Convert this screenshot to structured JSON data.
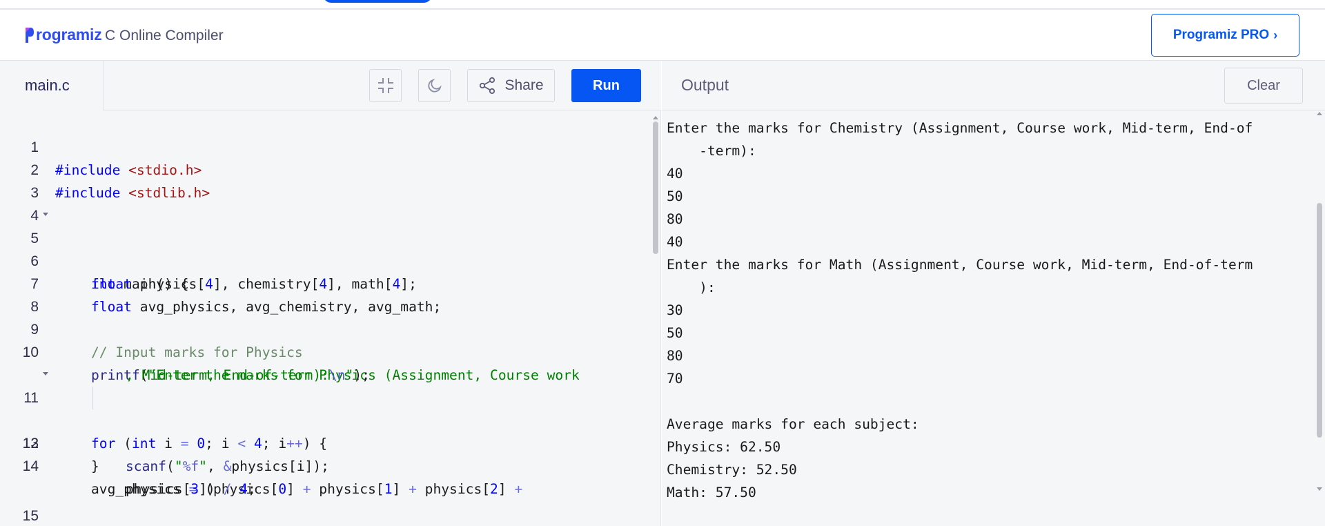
{
  "header": {
    "logo_text": "rogramiz",
    "title": "C Online Compiler",
    "pro_button": "Programiz PRO",
    "pro_chevron": "›"
  },
  "editor": {
    "file_tab": "main.c",
    "share_label": "Share",
    "run_label": "Run",
    "icons": [
      "collapse-icon",
      "moon-icon",
      "share-icon"
    ],
    "lines": [
      {
        "n": "1",
        "text": "#include <stdio.h>"
      },
      {
        "n": "2",
        "text": "#include <stdlib.h>"
      },
      {
        "n": "3",
        "text": ""
      },
      {
        "n": "4",
        "text": ""
      },
      {
        "n": "5",
        "text": "int main() {"
      },
      {
        "n": "6",
        "text": "float physics[4], chemistry[4], math[4];"
      },
      {
        "n": "7",
        "text": "float avg_physics, avg_chemistry, avg_math;"
      },
      {
        "n": "8",
        "text": ""
      },
      {
        "n": "9",
        "text": "// Input marks for Physics"
      },
      {
        "n": "10",
        "text": "printf(\"Enter the marks for Physics (Assignment, Course work, Mid-term, End-of-term):\\n\");"
      },
      {
        "n": "11",
        "text": "for (int i = 0; i < 4; i++) {"
      },
      {
        "n": "12",
        "text": "scanf(\"%f\", &physics[i]);"
      },
      {
        "n": "13",
        "text": "}"
      },
      {
        "n": "14",
        "text": "avg_physics = (physics[0] + physics[1] + physics[2] + physics[3]) / 4;"
      },
      {
        "n": "15",
        "text": ""
      }
    ]
  },
  "output": {
    "title": "Output",
    "clear_label": "Clear",
    "lines": [
      "Enter the marks for Chemistry (Assignment, Course work, Mid-term, End-of",
      "    -term):",
      "40",
      "50",
      "80",
      "40",
      "Enter the marks for Math (Assignment, Course work, Mid-term, End-of-term",
      "    ):",
      "30",
      "50",
      "80",
      "70",
      "",
      "Average marks for each subject:",
      "Physics: 62.50",
      "Chemistry: 52.50",
      "Math: 57.50"
    ]
  },
  "colors": {
    "accent": "#0556f3",
    "logo": "#2f4ef0",
    "keyword": "#0000ff",
    "string": "#a31515",
    "comment": "#6a8a6a"
  }
}
